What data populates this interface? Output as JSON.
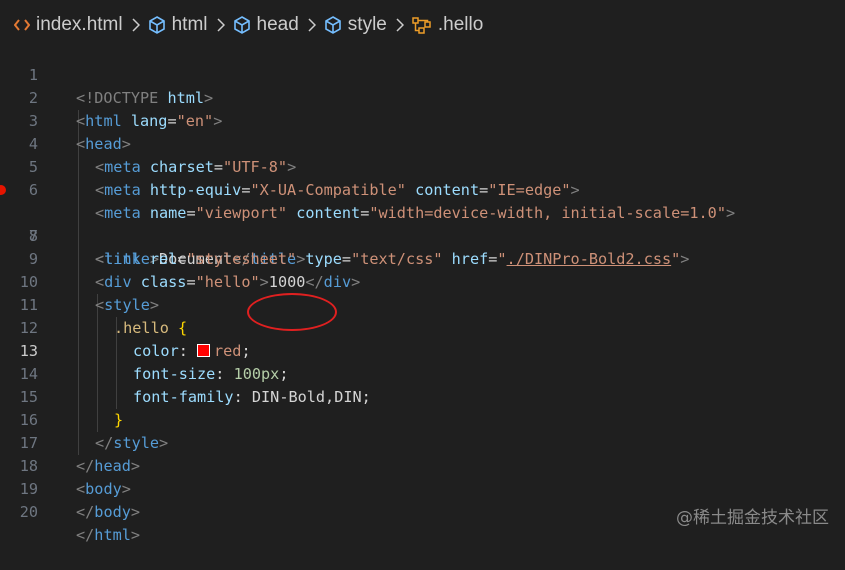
{
  "breadcrumb": {
    "items": [
      {
        "label": "index.html",
        "icon": "html-file-icon"
      },
      {
        "label": "html",
        "icon": "element-cube-icon"
      },
      {
        "label": "head",
        "icon": "element-cube-icon"
      },
      {
        "label": "style",
        "icon": "element-cube-icon"
      },
      {
        "label": ".hello",
        "icon": "css-selector-icon"
      }
    ]
  },
  "editor": {
    "active_line": 13,
    "breakpoint_line": 7,
    "line_numbers": [
      "1",
      "2",
      "3",
      "4",
      "5",
      "6",
      "7",
      "8",
      "9",
      "10",
      "11",
      "12",
      "13",
      "14",
      "15",
      "16",
      "17",
      "18",
      "19",
      "20"
    ],
    "tokens": {
      "l1": [
        "<!DOCTYPE",
        " html",
        ">"
      ],
      "l2": [
        "<",
        "html",
        " lang",
        "=",
        "\"en\"",
        ">"
      ],
      "l3": [
        "<",
        "head",
        ">"
      ],
      "l4": [
        "<",
        "meta",
        " charset",
        "=",
        "\"UTF-8\"",
        ">"
      ],
      "l5": [
        "<",
        "meta",
        " http-equiv",
        "=",
        "\"X-UA-Compatible\"",
        " content",
        "=",
        "\"IE=edge\"",
        ">"
      ],
      "l6": [
        "<",
        "meta",
        " name",
        "=",
        "\"viewport\"",
        " content",
        "=",
        "\"width=device-width, initial-scale=1.0\"",
        ">"
      ],
      "l7": [
        "<",
        "title",
        ">",
        "Document",
        "</",
        "title",
        ">"
      ],
      "l8": [
        "<",
        "link",
        " rel",
        "=",
        "\"stylesheet\"",
        " type",
        "=",
        "\"text/css\"",
        " href",
        "=",
        "\"",
        "./DINPro-Bold2.css",
        "\"",
        ">"
      ],
      "l9": [
        "<",
        "div",
        " class",
        "=",
        "\"hello\"",
        ">",
        "1000",
        "</",
        "div",
        ">"
      ],
      "l10": [
        "<",
        "style",
        ">"
      ],
      "l11": [
        ".hello",
        " {"
      ],
      "l12": [
        "color",
        ": ",
        "red",
        ";"
      ],
      "l13": [
        "font-size",
        ": ",
        "100px",
        ";"
      ],
      "l14": [
        "font-family",
        ": ",
        "DIN-Bold",
        ",DIN;"
      ],
      "l15": [
        "}"
      ],
      "l16": [
        "</",
        "style",
        ">"
      ],
      "l17": [
        "</",
        "head",
        ">"
      ],
      "l18": [
        "<",
        "body",
        ">"
      ],
      "l19": [
        "</",
        "body",
        ">"
      ],
      "l20": [
        "</",
        "html",
        ">"
      ]
    },
    "color_swatch": "#ff0000"
  },
  "annotation": {
    "color": "#e02020",
    "shape": "ellipse",
    "target": "DIN-Bold"
  },
  "watermark": "@稀土掘金技术社区"
}
